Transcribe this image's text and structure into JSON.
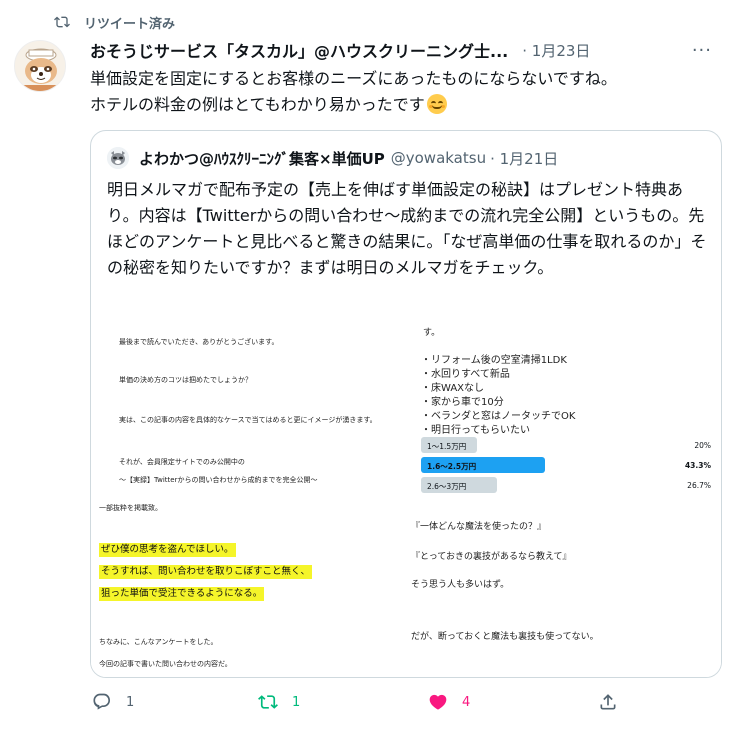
{
  "retweet_label": "リツイート済み",
  "tweet": {
    "author": "おそうじサービス「タスカル」@ハウスクリーニング士...",
    "date": "· 1月23日",
    "more": "···",
    "text_line1": "単価設定を固定にするとお客様のニーズにあったものにならないですね。",
    "text_line2": "ホテルの料金の例はとてもわかり易かったです",
    "emoji": "smiling-face-emoji"
  },
  "quote": {
    "name": "よわかつ@ﾊｳｽｸﾘｰﾆﾝｸﾞ集客×単価UP",
    "handle": "@yowakatsu",
    "date": "· 1月21日",
    "text": "明日メルマガで配布予定の【売上を伸ばす単価設定の秘訣】はプレゼント特典あり。内容は【Twitterからの問い合わせ～成約までの流れ完全公開】というもの。先ほどのアンケートと見比べると驚きの結果に。「なぜ高単価の仕事を取れるのか」その秘密を知りたいですか？まずは明日のメルマガをチェック。"
  },
  "media": {
    "p1": [
      "最後まで読んでいただき、ありがとうございます。",
      "単価の決め方のコツは掴めたでしょうか？",
      "実は、この記事の内容を具体的なケースで当てはめると更にイメージが湧きます。",
      "それが、会員限定サイトでのみ公開中の",
      "～【実録】Twitterからの問い合わせから成約までを完全公開～"
    ],
    "p2_top": "す。",
    "p2_list": [
      "・リフォーム後の空室清掃1LDK",
      "・水回りすべて新品",
      "・床WAXなし",
      "・家から車で10分",
      "・ベランダと窓はノータッチでOK",
      "・明日行ってもらいたい"
    ],
    "poll": [
      {
        "label": "1～1.5万円",
        "pct": "20%",
        "value": 20,
        "bold": false
      },
      {
        "label": "1.6～2.5万円",
        "pct": "43.3%",
        "value": 43.3,
        "bold": true
      },
      {
        "label": "2.6～3万円",
        "pct": "26.7%",
        "value": 26.7,
        "bold": false
      }
    ],
    "p3_top": "一部抜粋を掲載致。",
    "p3_highlights": [
      "ぜひ僕の思考を盗んでほしい。",
      "そうすれば、問い合わせを取りこぼすこと無く、",
      "狙った単価で受注できるようになる。"
    ],
    "p3_bottom": [
      "ちなみに、こんなアンケートをした。",
      "今回の記事で書いた問い合わせの内容だ。"
    ],
    "p4": [
      "『一体どんな魔法を使ったの？』",
      "『とっておきの裏技があるなら教えて』",
      "そう思う人も多いはず。",
      "だが、断っておくと魔法も裏技も使ってない。"
    ]
  },
  "actions": {
    "reply_count": "1",
    "retweet_count": "1",
    "like_count": "4"
  },
  "colors": {
    "retweet_active": "#00ba7c",
    "like_active": "#f91880",
    "poll_winner": "#1da1f2",
    "poll_other": "#cfd9de",
    "highlight": "#f5f52a"
  }
}
